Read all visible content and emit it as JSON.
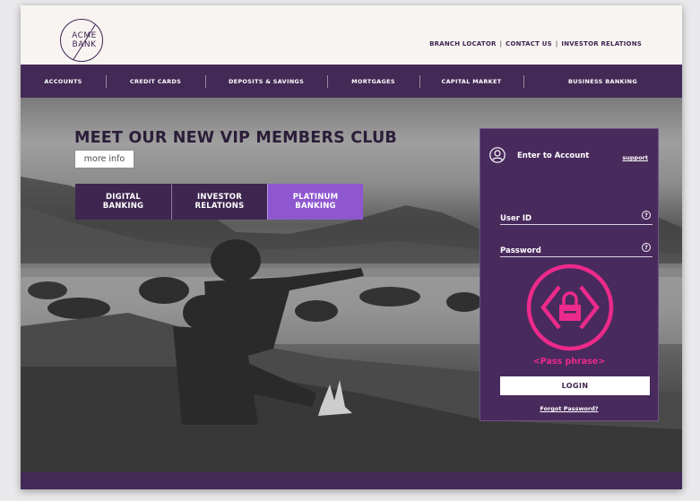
{
  "brand": {
    "logo_line1": "ACME",
    "logo_line2": "BANK",
    "primary_color": "#432955",
    "accent_color": "#8e57d0",
    "pass_color": "#ec2a8b"
  },
  "header": {
    "links": [
      "BRANCH LOCATOR",
      "CONTACT US",
      "INVESTOR RELATIONS"
    ],
    "separator": "|"
  },
  "nav": {
    "items": [
      "ACCOUNTS",
      "CREDIT CARDS",
      "DEPOSITS & SAVINGS",
      "MORTGAGES",
      "CAPITAL MARKET",
      "BUSINESS BANKING"
    ]
  },
  "hero": {
    "title": "MEET OUR NEW VIP MEMBERS CLUB",
    "more_info": "more info",
    "tiles": [
      {
        "line1": "DIGITAL",
        "line2": "BANKING"
      },
      {
        "line1": "INVESTOR",
        "line2": "RELATIONS"
      },
      {
        "line1": "PLATINUM",
        "line2": "BANKING"
      }
    ]
  },
  "login": {
    "title": "Enter to Account",
    "support": "support",
    "user_placeholder": "User ID",
    "password_placeholder": "Password",
    "help_glyph": "?",
    "pass_phrase": "<Pass phrase>",
    "button": "LOGIN",
    "forgot": "Forgot Password?",
    "icons": [
      "user-icon",
      "help-icon",
      "lock-icon"
    ]
  }
}
